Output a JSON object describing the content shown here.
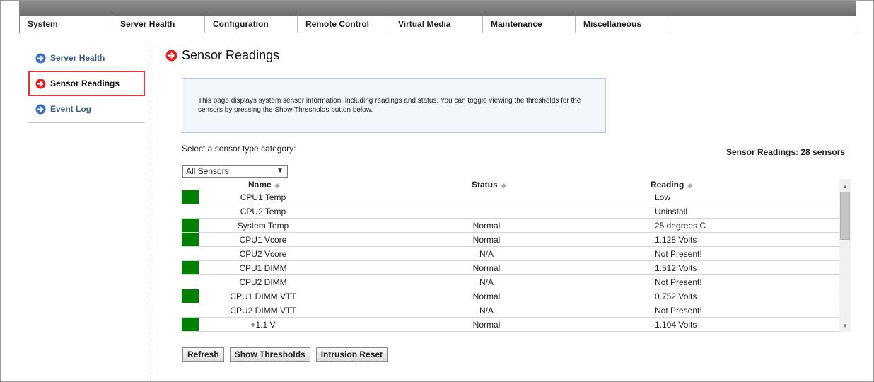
{
  "menu": [
    {
      "label": "System"
    },
    {
      "label": "Server Health"
    },
    {
      "label": "Configuration"
    },
    {
      "label": "Remote Control"
    },
    {
      "label": "Virtual Media"
    },
    {
      "label": "Maintenance"
    },
    {
      "label": "Miscellaneous"
    }
  ],
  "sidebar": {
    "items": [
      {
        "label": "Server Health",
        "icon": "arrow-circle-blue-icon"
      },
      {
        "label": "Sensor Readings",
        "icon": "arrow-circle-red-icon",
        "active": true
      },
      {
        "label": "Event Log",
        "icon": "arrow-circle-blue-icon"
      }
    ]
  },
  "page": {
    "title": "Sensor Readings",
    "info": "This page displays system sensor information, including readings and status. You can toggle viewing the thresholds for the sensors by pressing the Show Thresholds button below.",
    "select_label": "Select a sensor type category:",
    "count_label": "Sensor Readings: 28 sensors",
    "dropdown_value": "All Sensors"
  },
  "table": {
    "headers": {
      "name": "Name",
      "status": "Status",
      "reading": "Reading"
    },
    "rows": [
      {
        "name": "CPU1 Temp",
        "status": "",
        "reading": "Low",
        "indicator": true
      },
      {
        "name": "CPU2 Temp",
        "status": "",
        "reading": "Uninstall",
        "indicator": false
      },
      {
        "name": "System Temp",
        "status": "Normal",
        "reading": "25 degrees C",
        "indicator": true
      },
      {
        "name": "CPU1 Vcore",
        "status": "Normal",
        "reading": "1.128 Volts",
        "indicator": true
      },
      {
        "name": "CPU2 Vcore",
        "status": "N/A",
        "reading": "Not Present!",
        "indicator": false
      },
      {
        "name": "CPU1 DIMM",
        "status": "Normal",
        "reading": "1.512 Volts",
        "indicator": true
      },
      {
        "name": "CPU2 DIMM",
        "status": "N/A",
        "reading": "Not Present!",
        "indicator": false
      },
      {
        "name": "CPU1 DIMM VTT",
        "status": "Normal",
        "reading": "0.752 Volts",
        "indicator": true
      },
      {
        "name": "CPU2 DIMM VTT",
        "status": "N/A",
        "reading": "Not Present!",
        "indicator": false
      },
      {
        "name": "+1.1 V",
        "status": "Normal",
        "reading": "1.104 Volts",
        "indicator": true
      }
    ]
  },
  "buttons": {
    "refresh": "Refresh",
    "show_thresholds": "Show Thresholds",
    "intrusion_reset": "Intrusion Reset"
  },
  "colors": {
    "status_ok": "#008000",
    "active_outline": "#e03a3a",
    "link_blue": "#3e5e8a"
  }
}
